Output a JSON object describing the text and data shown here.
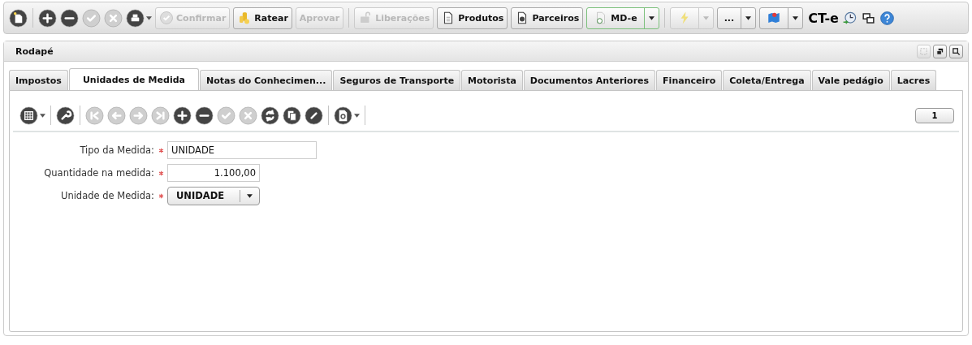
{
  "toolbar": {
    "icon_buttons": [
      {
        "disabled": false
      },
      {
        "disabled": false
      },
      {
        "disabled": false
      },
      {
        "disabled": true
      },
      {
        "disabled": true
      },
      {
        "disabled": false
      }
    ],
    "buttons": [
      {
        "label": "Confirmar",
        "disabled": true
      },
      {
        "label": "Ratear",
        "disabled": false
      },
      {
        "label": "Aprovar",
        "disabled": true
      },
      {
        "label": "Liberações",
        "disabled": true
      },
      {
        "label": "Produtos",
        "disabled": false
      },
      {
        "label": "Parceiros",
        "disabled": false
      }
    ],
    "split_buttons": [
      {
        "label": "MD-e",
        "highlighted": true,
        "disabled": false
      },
      {
        "highlighted": false,
        "disabled": true
      },
      {
        "label": "...",
        "highlighted": false,
        "disabled": false
      },
      {
        "highlighted": false,
        "disabled": false
      }
    ],
    "module": "CT-e"
  },
  "panel": {
    "title": "Rodapé",
    "window_buttons": [
      {
        "disabled": true
      },
      {
        "disabled": false
      },
      {
        "disabled": false
      }
    ],
    "tabs": [
      {
        "label": "Impostos",
        "selected": false
      },
      {
        "label": "Unidades de Medida",
        "selected": true
      },
      {
        "label": "Notas do Conhecimen...",
        "selected": false
      },
      {
        "label": "Seguros de Transporte",
        "selected": false
      },
      {
        "label": "Motorista",
        "selected": false
      },
      {
        "label": "Documentos Anteriores",
        "selected": false
      },
      {
        "label": "Financeiro",
        "selected": false
      },
      {
        "label": "Coleta/Entrega",
        "selected": false
      },
      {
        "label": "Vale pedágio",
        "selected": false
      },
      {
        "label": "Lacres",
        "selected": false
      }
    ],
    "record_toolbar": {
      "buttons": [
        {
          "disabled": false
        },
        {
          "disabled": false
        },
        {
          "disabled": true
        },
        {
          "disabled": true
        },
        {
          "disabled": true
        },
        {
          "disabled": true
        },
        {
          "disabled": false
        },
        {
          "disabled": false
        },
        {
          "disabled": true
        },
        {
          "disabled": true
        },
        {
          "disabled": false
        },
        {
          "disabled": false
        },
        {
          "disabled": false
        },
        {
          "disabled": false
        }
      ],
      "page": "1"
    },
    "fields": [
      {
        "label": "Tipo da Medida:",
        "required": true,
        "kind": "text",
        "value": "UNIDADE"
      },
      {
        "label": "Quantidade na medida:",
        "required": true,
        "kind": "number",
        "value": "1.100,00"
      },
      {
        "label": "Unidade de Medida:",
        "required": true,
        "kind": "select",
        "value": "UNIDADE"
      }
    ]
  }
}
